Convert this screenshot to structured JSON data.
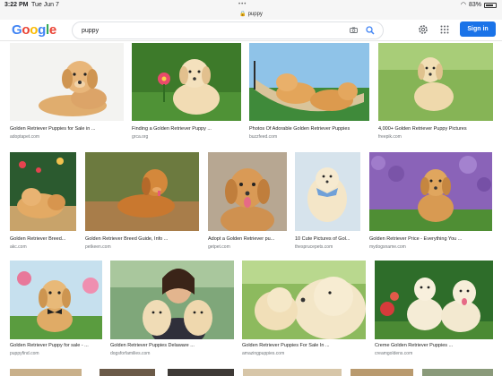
{
  "status_bar": {
    "time": "3:22 PM",
    "date": "Tue Jun 7",
    "battery": "83%"
  },
  "url_bar": {
    "text": "puppy"
  },
  "header": {
    "logo": {
      "l1": "G",
      "l2": "o",
      "l3": "o",
      "l4": "g",
      "l5": "l",
      "l6": "e"
    },
    "search_value": "puppy",
    "sign_in_label": "Sign in"
  },
  "results": [
    {
      "title": "Golden Retriever Puppies for Sale in ...",
      "source": "adoptapet.com"
    },
    {
      "title": "Finding a Golden Retriever Puppy ...",
      "source": "grca.org"
    },
    {
      "title": "Photos Of Adorable Golden Retriever Puppies",
      "source": "buzzfeed.com"
    },
    {
      "title": "4,000+ Golden Retriever Puppy Pictures",
      "source": "freepik.com"
    },
    {
      "title": "Golden Retriever Breed...",
      "source": "akc.com"
    },
    {
      "title": "Golden Retriever Breed Guide, Info ...",
      "source": "petkeen.com"
    },
    {
      "title": "Adopt a Golden Retriever pu...",
      "source": "getpet.com"
    },
    {
      "title": "10 Cute Pictures of Gol...",
      "source": "thesprucepets.com"
    },
    {
      "title": "Golden Retriever Price - Everything You ...",
      "source": "mydogsname.com"
    },
    {
      "title": "Golden Retriever Puppy for sale - ...",
      "source": "puppyfind.com"
    },
    {
      "title": "Golden Retriever Puppies Delaware ...",
      "source": "dogsforfamilies.com"
    },
    {
      "title": "Golden Retriever Puppies For Sale In ...",
      "source": "amazingpuppies.com"
    },
    {
      "title": "Creme Golden Retriever Puppies ...",
      "source": "creamgoldens.com"
    }
  ],
  "colors": {
    "accent": "#1a73e8",
    "puppy": "#d9a35c",
    "grass": "#5c9a3c"
  }
}
